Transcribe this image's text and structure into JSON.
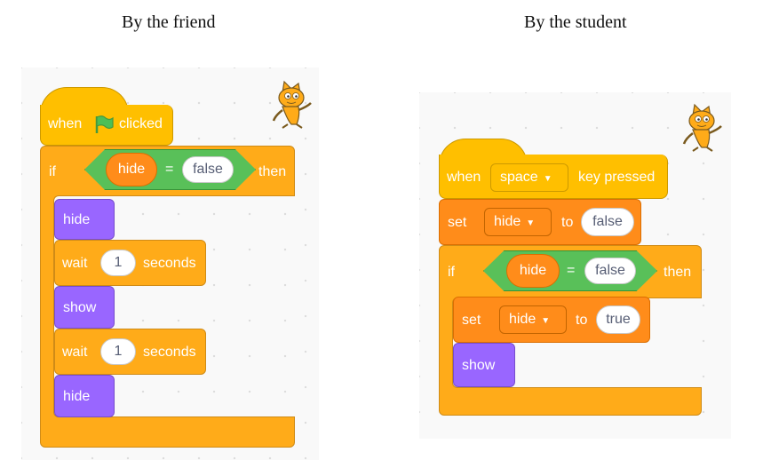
{
  "captions": {
    "left": "By the friend",
    "right": "By the student"
  },
  "friend": {
    "hat_when": "when",
    "hat_clicked": "clicked",
    "if_label": "if",
    "then_label": "then",
    "cond_var": "hide",
    "cond_eq": "=",
    "cond_value": "false",
    "hide1": "hide",
    "wait1_label": "wait",
    "wait1_value": "1",
    "wait1_unit": "seconds",
    "show": "show",
    "wait2_label": "wait",
    "wait2_value": "1",
    "wait2_unit": "seconds",
    "hide2": "hide"
  },
  "student": {
    "hat_when": "when",
    "hat_key": "space",
    "hat_pressed": "key pressed",
    "set1_label": "set",
    "set1_var": "hide",
    "set1_to": "to",
    "set1_value": "false",
    "if_label": "if",
    "then_label": "then",
    "cond_var": "hide",
    "cond_eq": "=",
    "cond_value": "false",
    "set2_label": "set",
    "set2_var": "hide",
    "set2_to": "to",
    "set2_value": "true",
    "show": "show"
  },
  "colors": {
    "events": "#ffbf00",
    "control": "#ffab19",
    "variables": "#ff8c1a",
    "looks": "#9966ff",
    "operators": "#59c059"
  },
  "icons": [
    "green-flag-icon",
    "sprite-cat-icon",
    "dropdown-caret-icon"
  ]
}
